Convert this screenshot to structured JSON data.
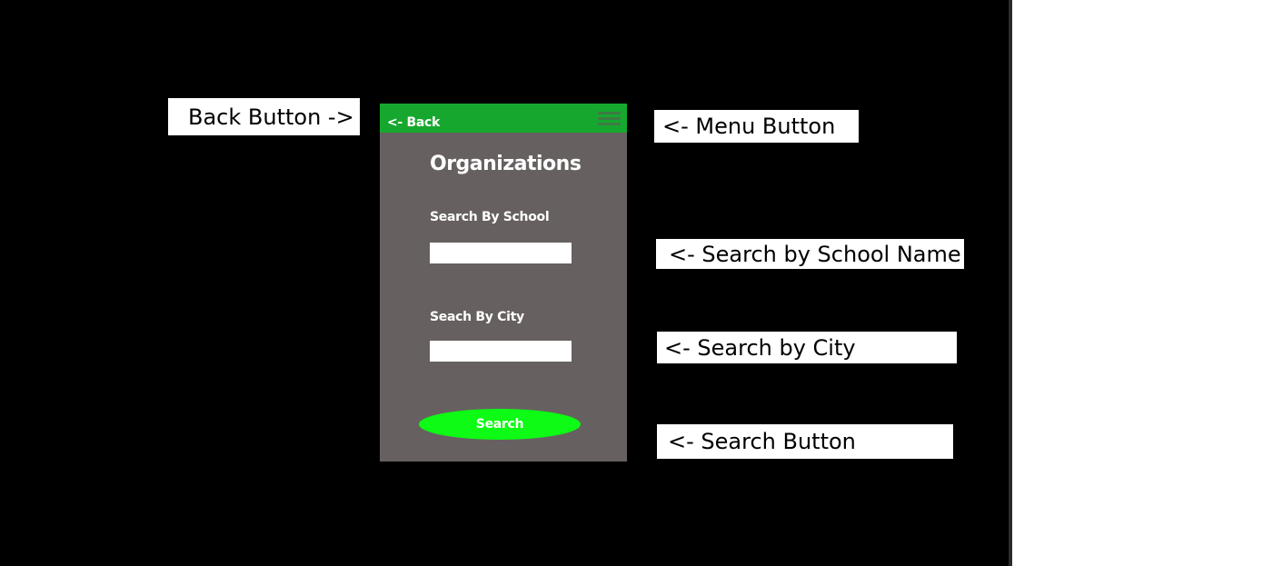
{
  "colors": {
    "background": "#000000",
    "phone_body": "#666160",
    "top_bar": "#16a82e",
    "menu_lines": "#3f7a45",
    "search_button": "#0dfb14",
    "callout_box": "#ffffff"
  },
  "callouts": {
    "back": "Back Button ->",
    "menu": "<- Menu Button",
    "school": "<- Search by School Name",
    "city": "<- Search by City",
    "search": "<- Search Button"
  },
  "phone": {
    "top_bar": {
      "back_label": "<- Back",
      "menu_icon": "hamburger-menu-icon"
    },
    "title": "Organizations",
    "school_field": {
      "label": "Search By School",
      "value": "",
      "placeholder": ""
    },
    "city_field": {
      "label": "Seach By City",
      "value": "",
      "placeholder": ""
    },
    "search_button_label": "Search"
  }
}
